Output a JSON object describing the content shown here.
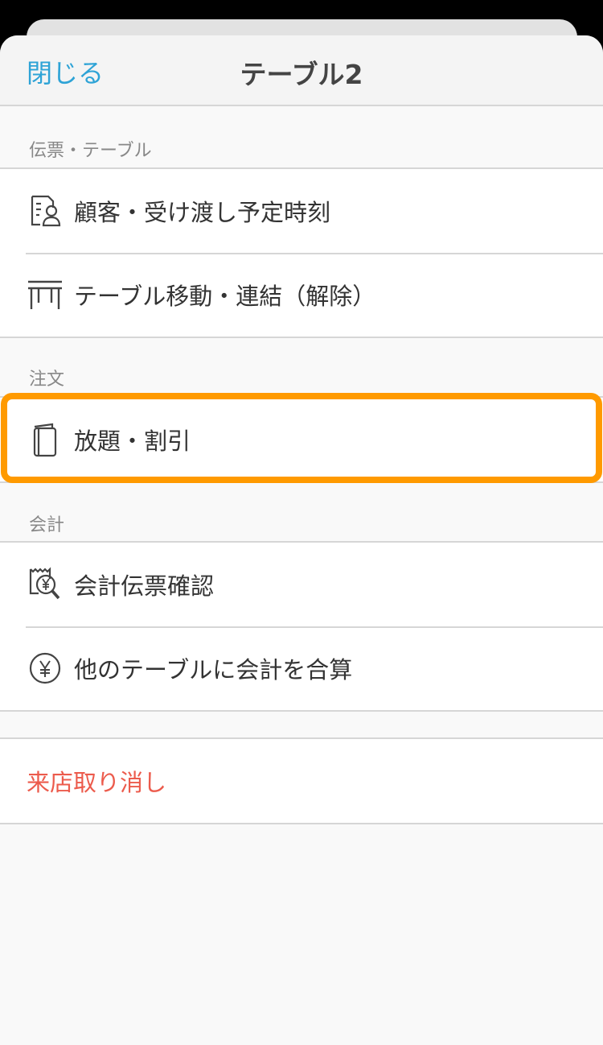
{
  "header": {
    "close_label": "閉じる",
    "title": "テーブル2"
  },
  "sections": {
    "slip_table": {
      "header": "伝票・テーブル",
      "items": [
        {
          "label": "顧客・受け渡し予定時刻",
          "icon": "customer-icon"
        },
        {
          "label": "テーブル移動・連結（解除）",
          "icon": "table-icon"
        }
      ]
    },
    "order": {
      "header": "注文",
      "items": [
        {
          "label": "放題・割引",
          "icon": "menu-book-icon"
        }
      ]
    },
    "payment": {
      "header": "会計",
      "items": [
        {
          "label": "会計伝票確認",
          "icon": "receipt-search-icon"
        },
        {
          "label": "他のテーブルに会計を合算",
          "icon": "yen-circle-icon"
        }
      ]
    }
  },
  "cancel_visit_label": "来店取り消し",
  "colors": {
    "accent": "#2ea3d6",
    "destructive": "#ec5b4c",
    "highlight": "#ff9a00"
  }
}
